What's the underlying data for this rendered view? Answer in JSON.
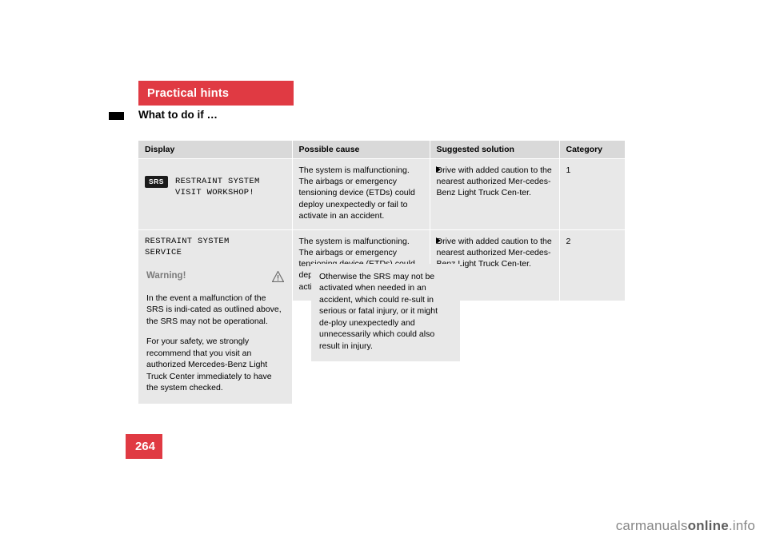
{
  "header": {
    "chapter": "Practical hints",
    "section": "What to do if …"
  },
  "table": {
    "columns": [
      "Display",
      "Possible cause",
      "Suggested solution",
      "Category"
    ],
    "rows": [
      {
        "display_badge": "SRS",
        "display_text": "RESTRAINT SYSTEM\nVISIT WORKSHOP!",
        "cause": "The system is malfunctioning. The airbags or emergency tensioning device (ETDs) could deploy unexpectedly or fail to activate in an accident.",
        "solution": "Drive with added caution to the nearest authorized Mer-cedes-Benz Light Truck Cen-ter.",
        "category": "1"
      },
      {
        "display_badge": "",
        "display_text": "RESTRAINT SYSTEM\nSERVICE",
        "cause": "The system is malfunctioning. The airbags or emergency tensioning device (ETDs) could deploy unexpectedly or fail to activate in an accident.",
        "solution": "Drive with added caution to the nearest authorized Mer-cedes-Benz Light Truck Cen-ter.",
        "category": "2"
      }
    ]
  },
  "warning": {
    "title": "Warning!",
    "paragraph1": "In the event a malfunction of the SRS is indi-cated as outlined above, the SRS may not be operational.",
    "paragraph2": "For your safety, we strongly recommend that you visit an authorized Mercedes-Benz Light Truck Center immediately to have the system checked.",
    "continuation": "Otherwise the SRS may not be activated when needed in an accident, which could re-sult in serious or fatal injury, or it might de-ploy unexpectedly and unnecessarily which could also result in injury."
  },
  "footer": {
    "page_number": "264",
    "watermark_light": "carmanuals",
    "watermark_bold": "online",
    "watermark_tail": ".info"
  }
}
